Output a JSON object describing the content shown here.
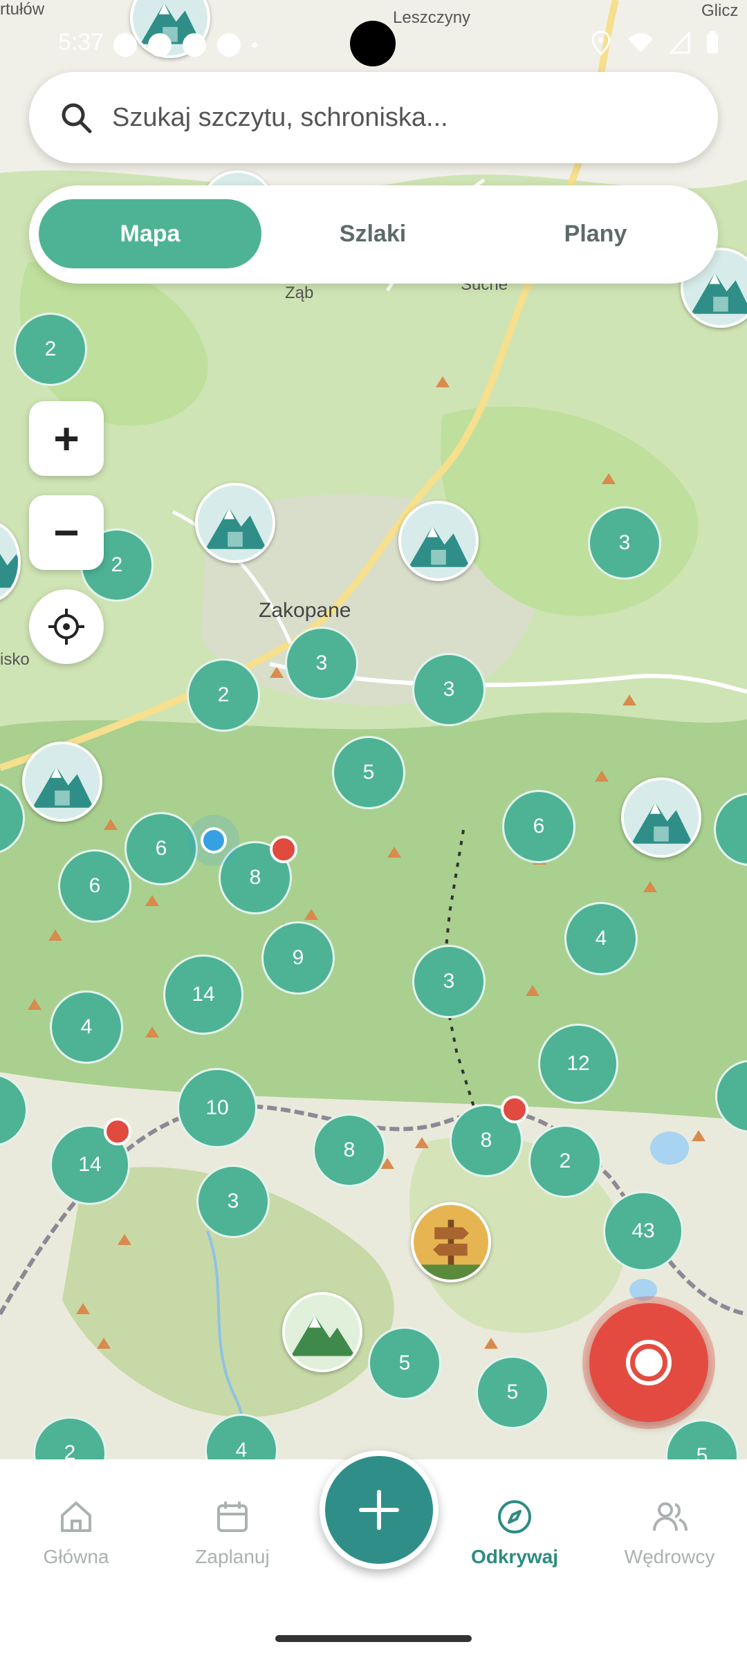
{
  "status_bar": {
    "time": "5:37"
  },
  "search": {
    "placeholder": "Szukaj szczytu, schroniska..."
  },
  "tabs": [
    {
      "label": "Mapa",
      "active": true
    },
    {
      "label": "Szlaki",
      "active": false
    },
    {
      "label": "Plany",
      "active": false
    }
  ],
  "map_controls": {
    "zoom_in": "+",
    "zoom_out": "−"
  },
  "map_labels": [
    {
      "text": "Leszczyny"
    },
    {
      "text": "Zakopane"
    },
    {
      "text": "Ząb"
    },
    {
      "text": "Suche"
    },
    {
      "text": "Glicz"
    },
    {
      "text": "isko"
    },
    {
      "text": "rtułów"
    }
  ],
  "clusters": [
    "2",
    "2",
    "3",
    "3",
    "2",
    "3",
    "5",
    "6",
    "6",
    "8",
    "6",
    "9",
    "14",
    "4",
    "3",
    "4",
    "12",
    "10",
    "14",
    "8",
    "3",
    "8",
    "2",
    "43",
    "5",
    "5",
    "2",
    "4",
    "5"
  ],
  "bottom_nav": [
    {
      "label": "Główna",
      "icon": "home-icon"
    },
    {
      "label": "Zaplanuj",
      "icon": "calendar-icon"
    },
    {
      "label": "Odkrywaj",
      "icon": "compass-icon",
      "active": true
    },
    {
      "label": "Wędrowcy",
      "icon": "users-icon"
    }
  ],
  "colors": {
    "accent": "#4db394",
    "nav_active": "#2d8b80",
    "record": "#e44b40",
    "fab": "#2f8f88"
  }
}
